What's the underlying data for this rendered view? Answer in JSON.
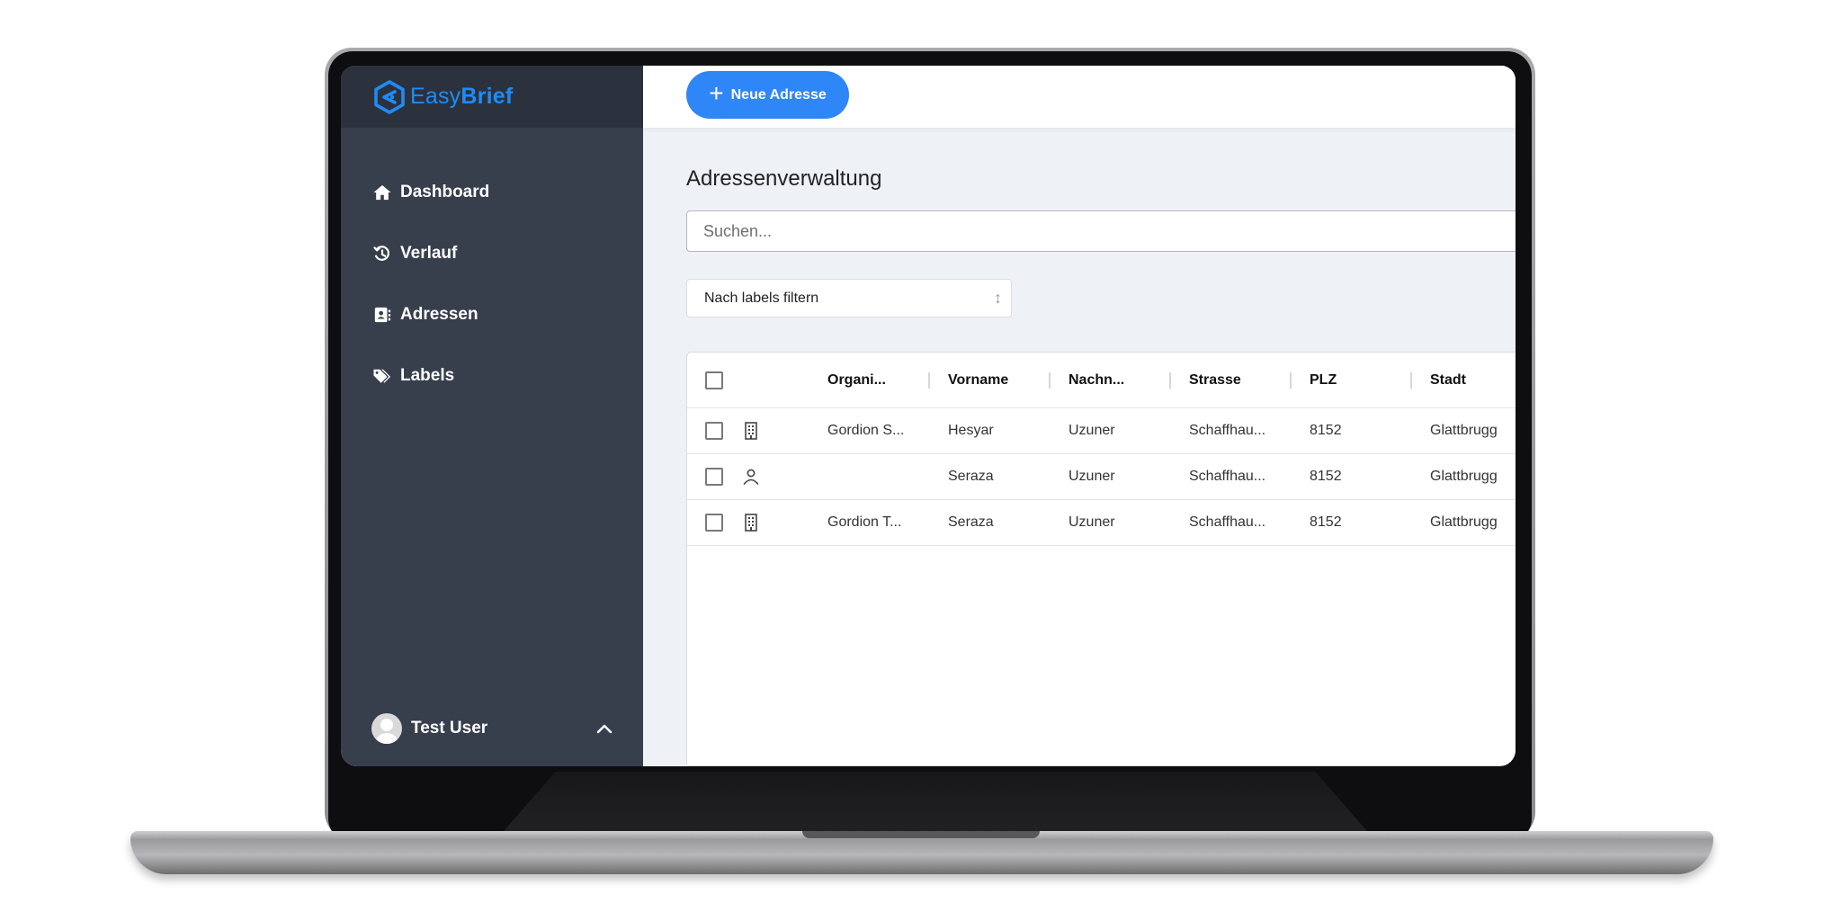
{
  "app": {
    "brand_light": "Easy",
    "brand_bold": "Brief",
    "accent_color": "#1d8cf8"
  },
  "sidebar": {
    "items": [
      {
        "label": "Dashboard",
        "icon": "home-icon"
      },
      {
        "label": "Verlauf",
        "icon": "history-icon"
      },
      {
        "label": "Adressen",
        "icon": "address-book-icon"
      },
      {
        "label": "Labels",
        "icon": "tags-icon"
      }
    ],
    "user": {
      "name": "Test User",
      "icon": "avatar"
    }
  },
  "topbar": {
    "new_address_label": "Neue Adresse"
  },
  "main": {
    "title": "Adressenverwaltung",
    "search": {
      "placeholder": "Suchen...",
      "value": ""
    },
    "filter": {
      "label": "Nach labels filtern"
    }
  },
  "table": {
    "columns": [
      "Organi...",
      "Vorname",
      "Nachn...",
      "Strasse",
      "PLZ",
      "Stadt"
    ],
    "rows": [
      {
        "type": "organization",
        "organisation": "Gordion S...",
        "vorname": "Hesyar",
        "nachname": "Uzuner",
        "strasse": "Schaffhau...",
        "plz": "8152",
        "stadt": "Glattbrugg"
      },
      {
        "type": "person",
        "organisation": "",
        "vorname": "Seraza",
        "nachname": "Uzuner",
        "strasse": "Schaffhau...",
        "plz": "8152",
        "stadt": "Glattbrugg"
      },
      {
        "type": "organization",
        "organisation": "Gordion T...",
        "vorname": "Seraza",
        "nachname": "Uzuner",
        "strasse": "Schaffhau...",
        "plz": "8152",
        "stadt": "Glattbrugg"
      }
    ]
  }
}
